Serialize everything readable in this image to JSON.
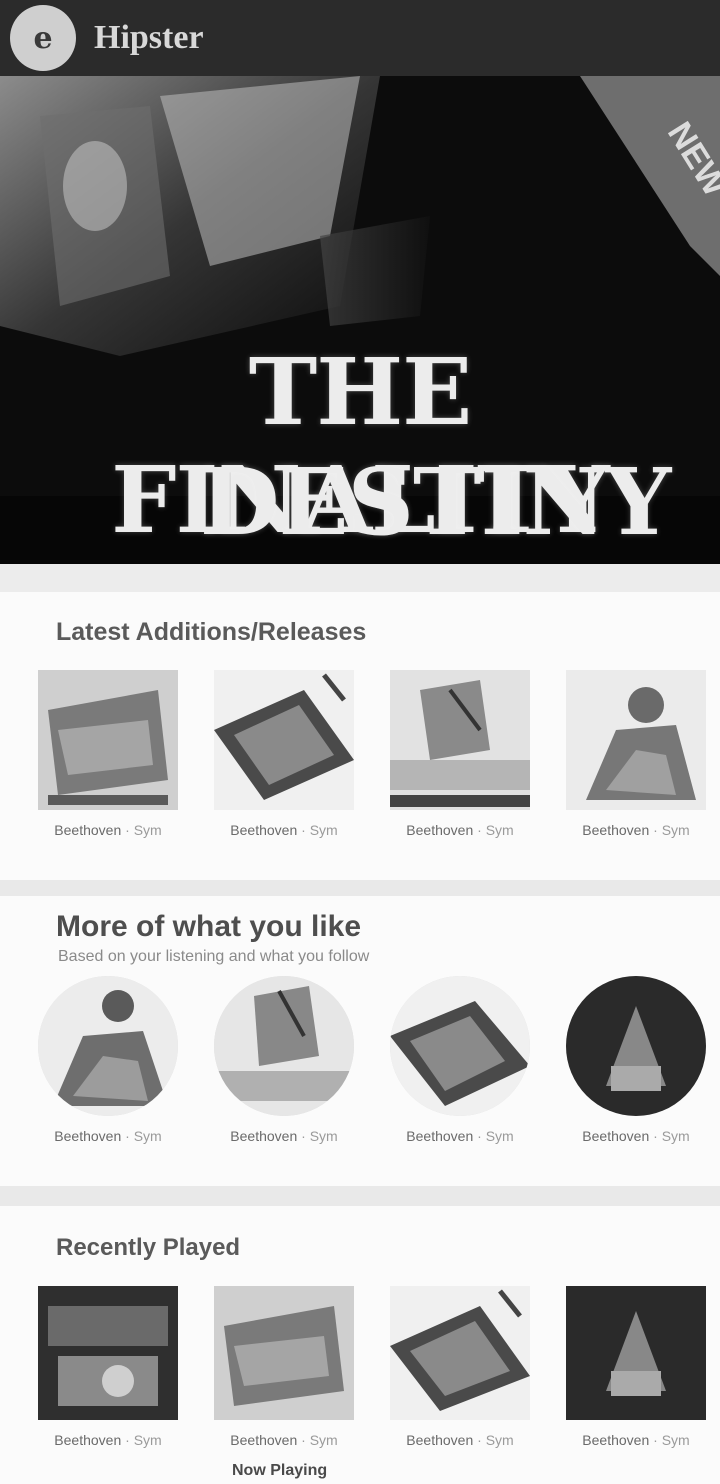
{
  "header": {
    "logo_letter": "e",
    "brand": "Hipster"
  },
  "hero": {
    "line1": "THE FINALITY",
    "line2": "DESTINY",
    "corner_tag": "NEW"
  },
  "sections": [
    {
      "title": "Latest Additions/Releases",
      "subtitle": "",
      "items": [
        {
          "caption": "Beethoven",
          "caption_dim": "· Sym",
          "icon": "album-cover"
        },
        {
          "caption": "Beethoven",
          "caption_dim": "· Sym",
          "icon": "album-cover"
        },
        {
          "caption": "Beethoven",
          "caption_dim": "· Sym",
          "icon": "album-cover"
        },
        {
          "caption": "Beethoven",
          "caption_dim": "· Sym",
          "icon": "album-cover"
        }
      ]
    },
    {
      "title": "More of what you like",
      "subtitle": "Based on your listening and what you follow",
      "items": [
        {
          "caption": "Beethoven",
          "caption_dim": "· Sym",
          "icon": "album-cover"
        },
        {
          "caption": "Beethoven",
          "caption_dim": "· Sym",
          "icon": "album-cover"
        },
        {
          "caption": "Beethoven",
          "caption_dim": "· Sym",
          "icon": "album-cover"
        },
        {
          "caption": "Beethoven",
          "caption_dim": "· Sym",
          "icon": "artist-avatar"
        }
      ]
    },
    {
      "title": "Recently Played",
      "subtitle": "",
      "items": [
        {
          "caption": "Beethoven",
          "caption_dim": "· Sym",
          "icon": "album-cover"
        },
        {
          "caption": "Beethoven",
          "caption_dim": "· Sym",
          "icon": "album-cover"
        },
        {
          "caption": "Beethoven",
          "caption_dim": "· Sym",
          "icon": "album-cover"
        },
        {
          "caption": "Beethoven",
          "caption_dim": "· Sym",
          "icon": "album-cover"
        }
      ]
    }
  ],
  "footer": {
    "label": "Now Playing"
  }
}
